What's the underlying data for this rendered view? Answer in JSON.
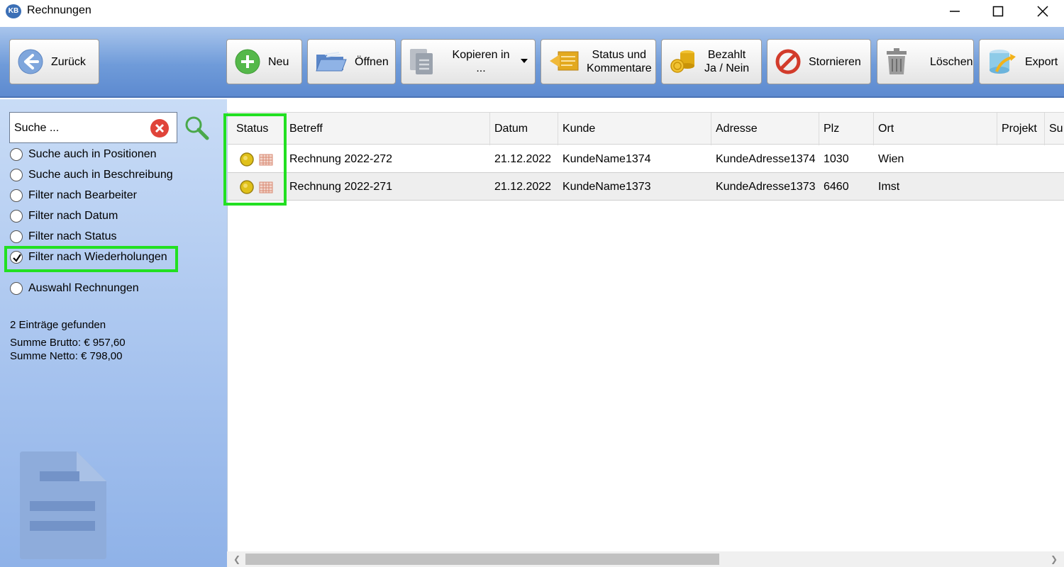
{
  "window": {
    "logo_text": "KB",
    "title": "Rechnungen"
  },
  "toolbar": {
    "back_label": "Zurück",
    "new_label": "Neu",
    "open_label": "Öffnen",
    "copy_label": "Kopieren in ...",
    "status_line1": "Status und",
    "status_line2": "Kommentare",
    "paid_line1": "Bezahlt",
    "paid_line2": "Ja / Nein",
    "cancel_label": "Stornieren",
    "delete_label": "Löschen",
    "export_label": "Export"
  },
  "search": {
    "placeholder": "Suche ..."
  },
  "options": [
    {
      "label": "Suche auch in Positionen",
      "checked": false
    },
    {
      "label": "Suche auch in Beschreibung",
      "checked": false
    },
    {
      "label": "Filter nach Bearbeiter",
      "checked": false
    },
    {
      "label": "Filter nach Datum",
      "checked": false
    },
    {
      "label": "Filter nach Status",
      "checked": false
    },
    {
      "label": "Filter nach Wiederholungen",
      "checked": true
    },
    {
      "label": "Auswahl Rechnungen",
      "checked": false
    }
  ],
  "summary": {
    "found": "2 Einträge gefunden",
    "brutto": "Summe Brutto: € 957,60",
    "netto": "Summe Netto: € 798,00"
  },
  "table": {
    "columns": [
      "Status",
      "Betreff",
      "Datum",
      "Kunde",
      "Adresse",
      "Plz",
      "Ort",
      "Projekt",
      "Su"
    ],
    "rows": [
      {
        "betreff": "Rechnung 2022-272",
        "datum": "21.12.2022",
        "kunde": "KundeName1374",
        "adresse": "KundeAdresse1374",
        "plz": "1030",
        "ort": "Wien",
        "projekt": ""
      },
      {
        "betreff": "Rechnung 2022-271",
        "datum": "21.12.2022",
        "kunde": "KundeName1373",
        "adresse": "KundeAdresse1373",
        "plz": "6460",
        "ort": "Imst",
        "projekt": ""
      }
    ]
  },
  "colors": {
    "highlight": "#22e022",
    "toolbar_top": "#a9c5ec",
    "toolbar_bottom": "#5d8ad0",
    "status_dot": "#e0c11a"
  }
}
